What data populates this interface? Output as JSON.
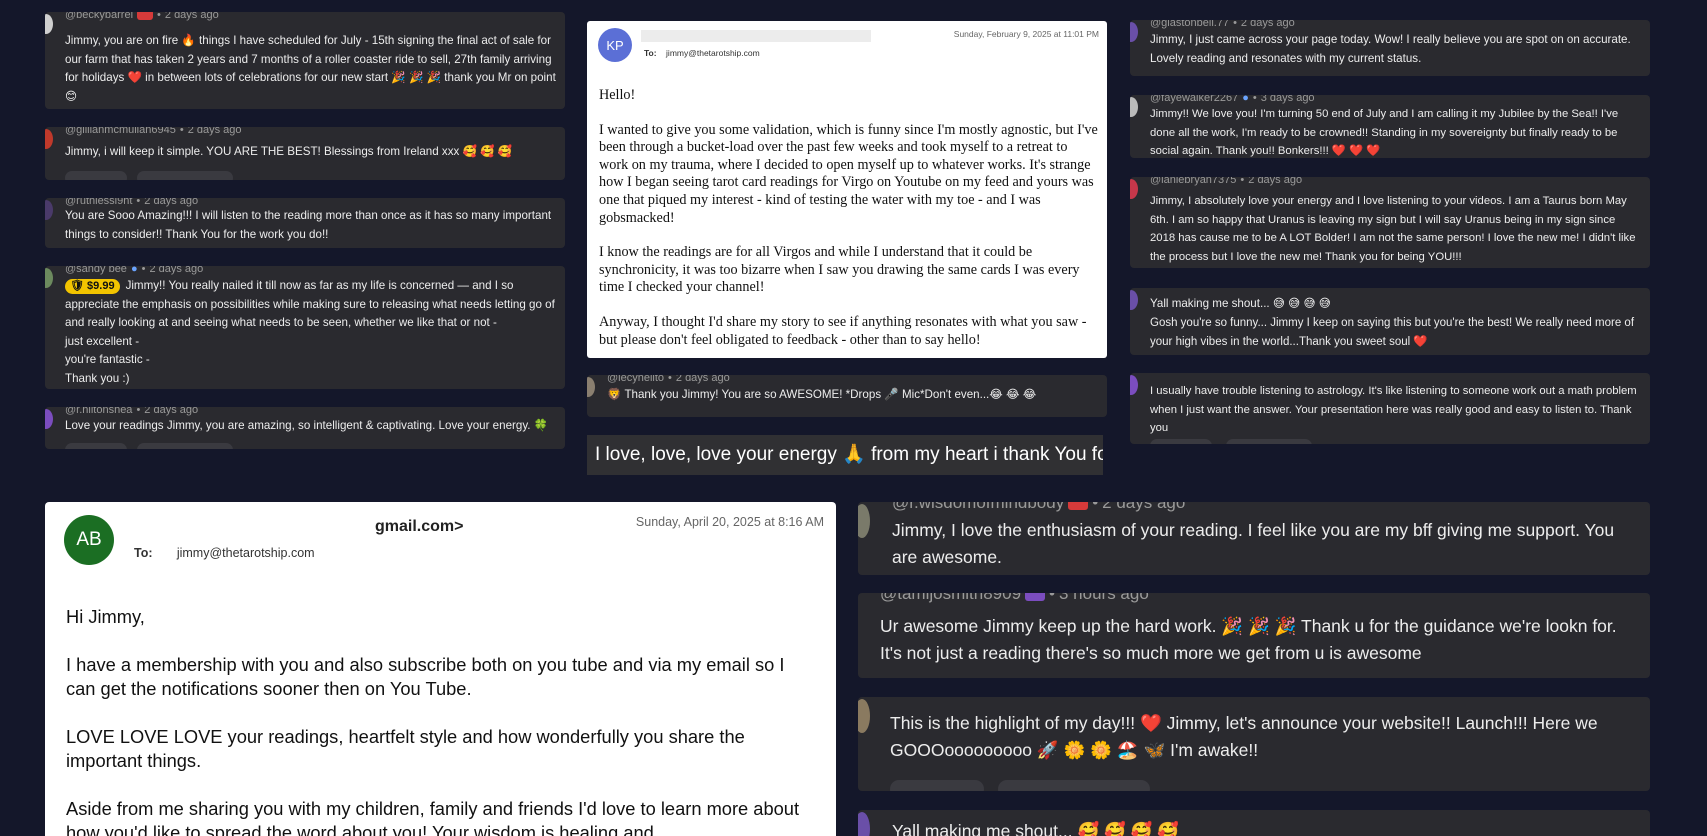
{
  "colors": {
    "bg": "#14172a",
    "card": "#2a2a2f",
    "meta": "#9a9a9a",
    "gold": "#f2c400",
    "email_avatar_kp": "#5b6fd6",
    "email_avatar_ab": "#1b6e23"
  },
  "left_comments": [
    {
      "handle": "@beckybarrel",
      "time": "2 days ago",
      "text": "Jimmy, you are on fire 🔥 things I have scheduled for July - 15th signing the final act of sale for our farm that has taken 2 years and 7 months of a roller coaster ride to sell, 27th family arriving for holidays ❤️ in between lots of celebrations for our new start 🎉 🎉 🎉 thank you Mr on point 😊"
    },
    {
      "handle": "@gillianmcmullan6945",
      "time": "2 days ago",
      "text": "Jimmy, i will keep it simple. YOU ARE THE BEST! Blessings from Ireland xxx 🥰 🥰 🥰"
    },
    {
      "handle": "@ruthlessl9ht",
      "time": "2 days ago",
      "text": "You are Sooo Amazing!!! I will listen to the reading more than once as it has so many important things to consider!! Thank You for the work you do!!"
    },
    {
      "handle": "@sandy bee",
      "time": "2 days ago",
      "badge": "$9.99",
      "text": "Jimmy!! You really nailed it till now as far as my life is concerned — and I so appreciate the emphasis on possibilities while making sure to releasing what needs letting go of and really looking at and seeing what needs to be seen, whether we like that or not -",
      "extra": [
        "just excellent -",
        "you're fantastic -",
        "Thank you :)"
      ]
    },
    {
      "handle": "@r.hiltonshea",
      "time": "2 days ago",
      "text": "Love your readings Jimmy, you are amazing, so intelligent & captivating. Love your energy. 🍀"
    }
  ],
  "email_kp": {
    "initials": "KP",
    "date": "Sunday, February 9, 2025 at 11:01 PM",
    "to_label": "To:",
    "to": "jimmy@thetarotship.com",
    "greeting": "Hello!",
    "p1": "I wanted to give you some validation, which is funny since I'm mostly agnostic, but I've been through a bucket-load over the past few weeks and took myself to a retreat to work on my trauma, where I decided to open myself up to whatever works. It's strange how I began seeing tarot card readings for Virgo on Youtube on my feed and yours was one that piqued my interest - kind of testing the water with my toe - and I was gobsmacked!",
    "p2": "I know the readings are for all Virgos and while I understand that it could be synchronicity, it was too bizarre when I saw you drawing the same cards I was every time I checked your channel!",
    "p3": "Anyway, I thought I'd share my story to see if anything resonates with what you saw - but please don't feel obligated to feedback - other than to say hello!"
  },
  "mid_comment": {
    "handle": "@lecyhelito",
    "time": "2 days ago",
    "text": "🦁 Thank you Jimmy! You are so AWESOME! *Drops 🎤 Mic*Don't even...😂 😂 😂"
  },
  "caption": "I love, love, love your energy 🙏 from my heart i thank You for being here 💛",
  "right_comments": [
    {
      "handle": "@glastonbell.77",
      "time": "2 days ago",
      "text": "Jimmy, I just came across your page today. Wow! I really believe you are spot on on accurate. Lovely reading and resonates with my current status."
    },
    {
      "handle": "@fayewalker2267",
      "time": "3 days ago",
      "text": "Jimmy!! We love you! I'm turning 50 end of July and I am calling it my Jubilee by the Sea!! I've done all the work, I'm ready to be crowned!! Standing in my sovereignty but finally ready to be social again. Thank you!! Bonkers!!! ❤️ ❤️ ❤️"
    },
    {
      "handle": "@laniebryan7375",
      "time": "2 days ago",
      "text": "Jimmy, I absolutely love your energy and I love listening to your videos. I am a Taurus born May 6th. I am so happy that Uranus is leaving my sign but I will say Uranus being in my sign since 2018 has cause me to be A LOT Bolder! I am not the same person! I love the new me! I didn't like the process but I love the new me! Thank you for being YOU!!!"
    },
    {
      "title": "Yall making me shout... 😅 😅 😅 😅",
      "text": "Gosh you're so funny... Jimmy I keep on saying this but you're the best! We really need more of your high vibes in the world...Thank you sweet soul ❤️"
    },
    {
      "text": "I usually have trouble listening to astrology. It's like listening to someone work out a math problem when I just want the answer. Your presentation here was really good and easy to listen to. Thank you"
    }
  ],
  "email_ab": {
    "initials": "AB",
    "from_tail": "ɡmail.com>",
    "date": "Sunday, April 20, 2025 at 8:16 AM",
    "to_label": "To:",
    "to": "jimmy@thetarotship.com",
    "greeting": "Hi Jimmy,",
    "p1": "I have a membership with you and also subscribe both on you tube and via my email so I can get the notifications sooner then on You Tube.",
    "p2": "LOVE LOVE LOVE your readings, heartfelt style and how wonderfully you share the important things.",
    "p3": "Aside from me sharing you with my children, family and friends I'd love to learn more about how you'd like to spread the word about you! Your wisdom is healing and"
  },
  "big_comments": [
    {
      "handle": "@r.wisdomofmindbody",
      "time": "2 days ago",
      "text": "Jimmy, I love the enthusiasm of your reading. I feel like you are my bff giving me support. You are awesome."
    },
    {
      "handle": "@tamijosmith8909",
      "time": "3 hours ago",
      "text": "Ur awesome Jimmy keep up the hard work. 🎉 🎉 🎉 Thank u for the guidance we're lookn for. It's not just a reading there's so much more we get from u is awesome"
    },
    {
      "text": "This is the highlight of my day!!! ❤️ Jimmy, let's announce your website!! Launch!!! Here we GOOOooooooooo 🚀 🌼 🌼 🏖️ 🦋 I'm awake!!"
    },
    {
      "text": "Yall making me shout... 🥰 🥰 🥰 🥰"
    }
  ]
}
